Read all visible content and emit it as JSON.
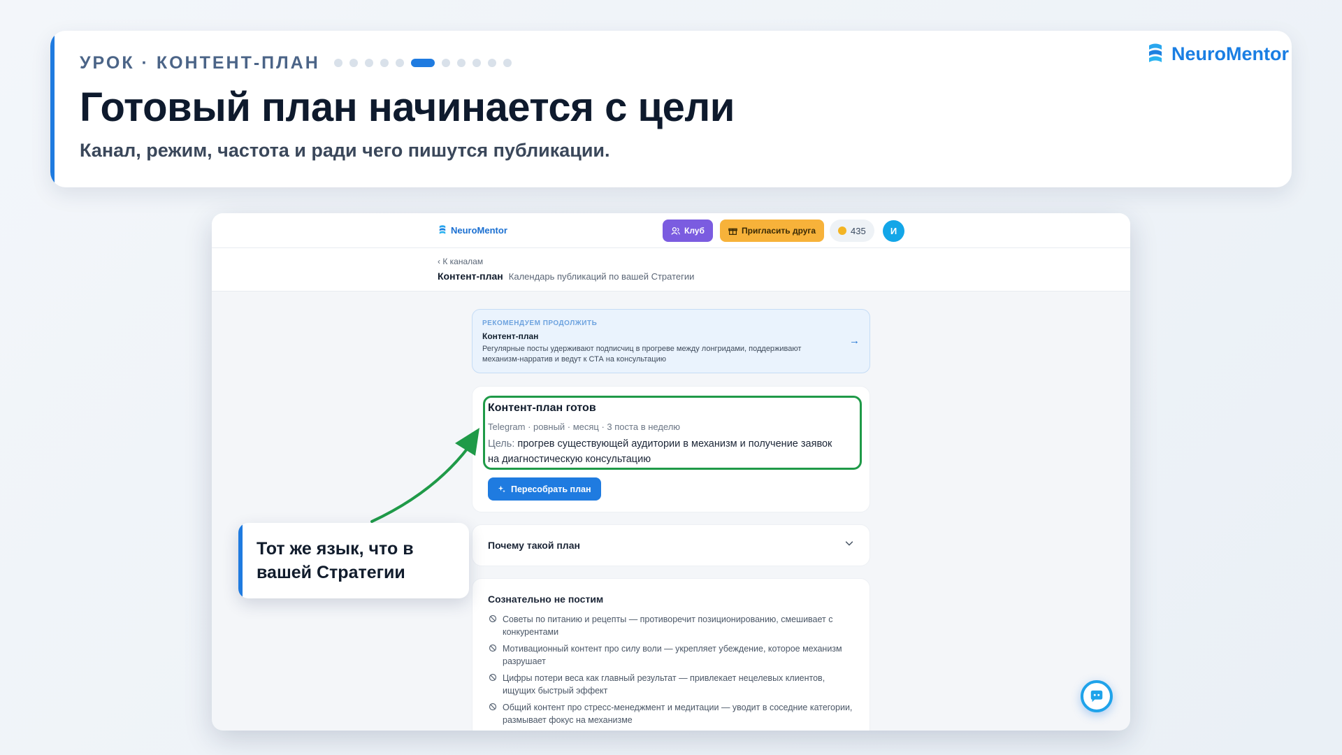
{
  "lesson": {
    "kicker": "УРОК · КОНТЕНТ-ПЛАН",
    "progress": {
      "total": 11,
      "current": 6
    },
    "title": "Готовый план начинается с цели",
    "subtitle": "Канал, режим, частота и ради чего пишутся публикации."
  },
  "brand": {
    "name": "NeuroMentor",
    "color": "#1a7ee3"
  },
  "app": {
    "logo": "NeuroMentor",
    "club_button": "Клуб",
    "invite_button": "Пригласить друга",
    "coins": "435",
    "avatar_initial": "И",
    "back_link": "‹ К каналам",
    "page_title": "Контент-план",
    "page_description": "Календарь публикаций по вашей Стратегии",
    "recommend": {
      "kicker": "РЕКОМЕНДУЕМ ПРОДОЛЖИТЬ",
      "title": "Контент-план",
      "description": "Регулярные посты удерживают подписчиц в прогреве между лонгридами, поддерживают механизм-нарратив и ведут к СТА на консультацию"
    },
    "plan": {
      "title": "Контент-план готов",
      "meta": "Telegram · ровный · месяц · 3 поста в неделю",
      "goal_label": "Цель:",
      "goal_text": "прогрев существующей аудитории в механизм и получение заявок на диагностическую консультацию",
      "rebuild_button": "Пересобрать план"
    },
    "why": {
      "label": "Почему такой план"
    },
    "dont_post": {
      "title": "Сознательно не постим",
      "items": [
        "Советы по питанию и рецепты — противоречит позиционированию, смешивает с конкурентами",
        "Мотивационный контент про силу воли — укрепляет убеждение, которое механизм разрушает",
        "Цифры потери веса как главный результат — привлекает нецелевых клиентов, ищущих быстрый эффект",
        "Общий контент про стресс-менеджмент и медитации — уводит в соседние категории, размывает фокус на механизме"
      ]
    }
  },
  "callout": {
    "text": "Тот же язык, что в вашей Стратегии"
  },
  "colors": {
    "accent": "#1f7be0",
    "highlight": "#1f9a48",
    "club": "#7b5ce0",
    "invite": "#f7b23a"
  }
}
